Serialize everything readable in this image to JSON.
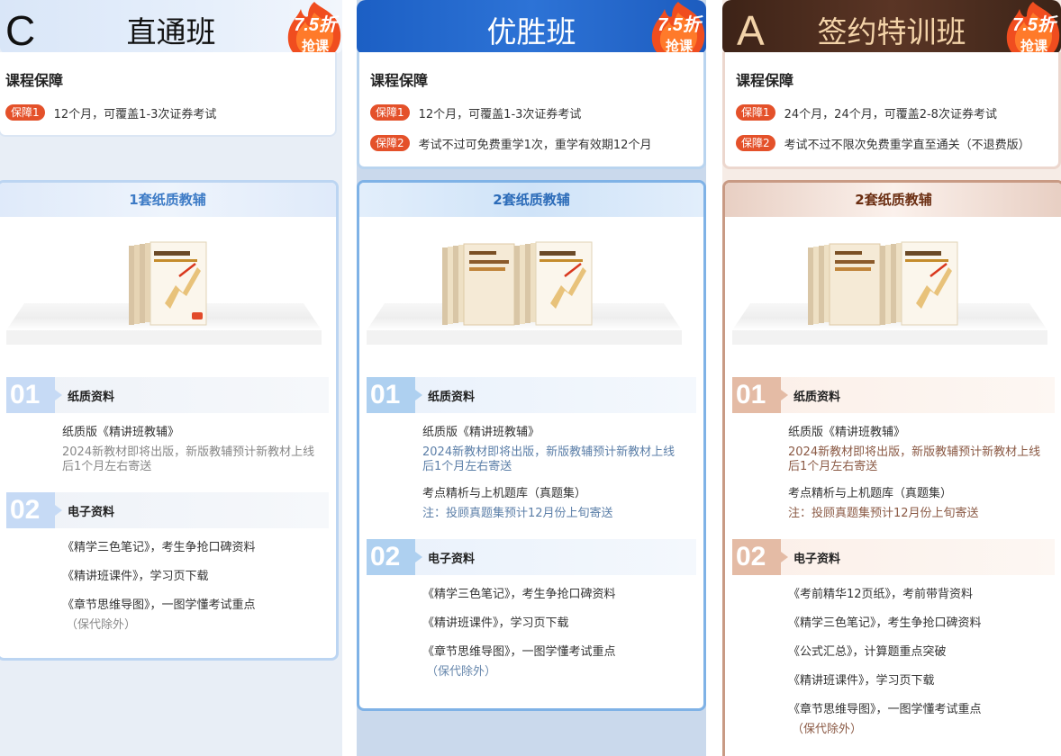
{
  "columns": {
    "c": {
      "letter": "C",
      "title": "直通班",
      "badge": {
        "top": "7.5折",
        "bottom": "抢课"
      },
      "guarantee_title": "课程保障",
      "guarantees": [
        {
          "tag": "保障1",
          "text": "12个月，可覆盖1-3次证券考试"
        }
      ],
      "material_title": "1套纸质教辅",
      "sections": {
        "paper": {
          "num": "01",
          "title": "纸质资料"
        },
        "digital": {
          "num": "02",
          "title": "电子资料"
        }
      },
      "paper_items": [
        {
          "name": "纸质版《精讲班教辅》",
          "note": "2024新教材即将出版，新版教辅预计新教材上线后1个月左右寄送"
        }
      ],
      "digital_items": [
        "《精学三色笔记》，考生争抢口碑资料",
        "《精讲班课件》，学习页下载",
        "《章节思维导图》，一图学懂考试重点"
      ],
      "digital_tail": "（保代除外）"
    },
    "b": {
      "title": "优胜班",
      "badge": {
        "top": "7.5折",
        "bottom": "抢课"
      },
      "guarantee_title": "课程保障",
      "guarantees": [
        {
          "tag": "保障1",
          "text": "12个月，可覆盖1-3次证券考试"
        },
        {
          "tag": "保障2",
          "text": "考试不过可免费重学1次，重学有效期12个月"
        }
      ],
      "material_title": "2套纸质教辅",
      "sections": {
        "paper": {
          "num": "01",
          "title": "纸质资料"
        },
        "digital": {
          "num": "02",
          "title": "电子资料"
        }
      },
      "paper_items": [
        {
          "name": "纸质版《精讲班教辅》",
          "note": "2024新教材即将出版，新版教辅预计新教材上线后1个月左右寄送"
        },
        {
          "name": "考点精析与上机题库（真题集）",
          "note": "注：投顾真题集预计12月份上旬寄送"
        }
      ],
      "digital_items": [
        "《精学三色笔记》，考生争抢口碑资料",
        "《精讲班课件》，学习页下载",
        "《章节思维导图》，一图学懂考试重点"
      ],
      "digital_tail": "（保代除外）"
    },
    "a": {
      "letter": "A",
      "title": "签约特训班",
      "badge": {
        "top": "7.5折",
        "bottom": "抢课"
      },
      "guarantee_title": "课程保障",
      "guarantees": [
        {
          "tag": "保障1",
          "text": "24个月，24个月，可覆盖2-8次证券考试"
        },
        {
          "tag": "保障2",
          "text": "考试不过不限次免费重学直至通关（不退费版）"
        }
      ],
      "material_title": "2套纸质教辅",
      "sections": {
        "paper": {
          "num": "01",
          "title": "纸质资料"
        },
        "digital": {
          "num": "02",
          "title": "电子资料"
        }
      },
      "paper_items": [
        {
          "name": "纸质版《精讲班教辅》",
          "note": "2024新教材即将出版，新版教辅预计新教材上线后1个月左右寄送"
        },
        {
          "name": "考点精析与上机题库（真题集）",
          "note": "注：投顾真题集预计12月份上旬寄送"
        }
      ],
      "digital_items": [
        "《考前精华12页纸》，考前带背资料",
        "《精学三色笔记》，考生争抢口碑资料",
        "《公式汇总》，计算题重点突破",
        "《精讲班课件》，学习页下载",
        "《章节思维导图》，一图学懂考试重点"
      ],
      "digital_tail": "（保代除外）"
    }
  },
  "colors": {
    "tag": "#e4512a",
    "blue_header": "#1c5fc4",
    "brown_header": "#3d2317",
    "gold_text": "#f3d3a8"
  },
  "icons": {
    "badge": "flame-discount-badge-icon",
    "books": "textbook-stack-image"
  }
}
